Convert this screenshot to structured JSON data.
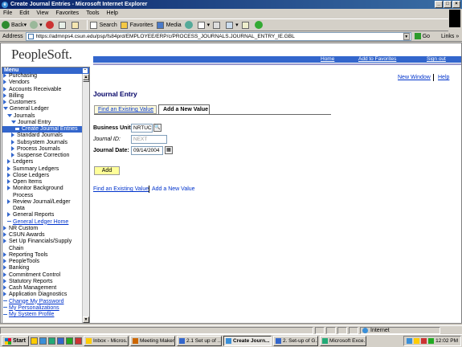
{
  "window": {
    "title": "Create Journal Entries - Microsoft Internet Explorer"
  },
  "menubar": [
    "File",
    "Edit",
    "View",
    "Favorites",
    "Tools",
    "Help"
  ],
  "toolbar": {
    "back": "Back",
    "search": "Search",
    "favorites": "Favorites",
    "media": "Media"
  },
  "address": {
    "label": "Address",
    "url": "https://admnps4.csun.edu/psp/fs84prd/EMPLOYEE/ERP/c/PROCESS_JOURNALS.JOURNAL_ENTRY_IE.GBL",
    "go": "Go",
    "links": "Links"
  },
  "header": {
    "logo": "PeopleSoft.",
    "nav": {
      "home": "Home",
      "add_favorites": "Add to Favorites",
      "sign_out": "Sign out"
    }
  },
  "menu": {
    "title": "Menu",
    "items": [
      {
        "label": "Purchasing",
        "type": "arrow",
        "indent": 0
      },
      {
        "label": "Vendors",
        "type": "arrow",
        "indent": 0
      },
      {
        "label": "Accounts Receivable",
        "type": "arrow",
        "indent": 0
      },
      {
        "label": "Billing",
        "type": "arrow",
        "indent": 0
      },
      {
        "label": "Customers",
        "type": "arrow",
        "indent": 0
      },
      {
        "label": "General Ledger",
        "type": "open",
        "indent": 0
      },
      {
        "label": "Journals",
        "type": "open",
        "indent": 1
      },
      {
        "label": "Journal Entry",
        "type": "open",
        "indent": 2
      },
      {
        "label": "Create Journal Entries",
        "type": "selected",
        "indent": 3
      },
      {
        "label": "Standard Journals",
        "type": "arrow",
        "indent": 2
      },
      {
        "label": "Subsystem Journals",
        "type": "arrow",
        "indent": 2
      },
      {
        "label": "Process Journals",
        "type": "arrow",
        "indent": 2
      },
      {
        "label": "Suspense Correction",
        "type": "arrow",
        "indent": 2
      },
      {
        "label": "Ledgers",
        "type": "arrow",
        "indent": 1
      },
      {
        "label": "Summary Ledgers",
        "type": "arrow",
        "indent": 1
      },
      {
        "label": "Close Ledgers",
        "type": "arrow",
        "indent": 1
      },
      {
        "label": "Open Items",
        "type": "arrow",
        "indent": 1
      },
      {
        "label": "Monitor Background",
        "type": "arrow",
        "indent": 1
      },
      {
        "label": "Process",
        "type": "cont",
        "indent": 1
      },
      {
        "label": "Review Journal/Ledger",
        "type": "arrow",
        "indent": 1
      },
      {
        "label": "Data",
        "type": "cont",
        "indent": 1
      },
      {
        "label": "General Reports",
        "type": "arrow",
        "indent": 1
      },
      {
        "label": "General Ledger Home",
        "type": "link",
        "indent": 1
      },
      {
        "label": "NR Custom",
        "type": "arrow",
        "indent": 0
      },
      {
        "label": "CSUN Awards",
        "type": "arrow",
        "indent": 0
      },
      {
        "label": "Set Up Financials/Supply",
        "type": "arrow",
        "indent": 0
      },
      {
        "label": "Chain",
        "type": "cont",
        "indent": 0
      },
      {
        "label": "Reporting Tools",
        "type": "arrow",
        "indent": 0
      },
      {
        "label": "PeopleTools",
        "type": "arrow",
        "indent": 0
      },
      {
        "label": "Banking",
        "type": "arrow",
        "indent": 0
      },
      {
        "label": "Commitment Control",
        "type": "arrow",
        "indent": 0
      },
      {
        "label": "Statutory Reports",
        "type": "arrow",
        "indent": 0
      },
      {
        "label": "Cash Management",
        "type": "arrow",
        "indent": 0
      },
      {
        "label": "Application Diagnostics",
        "type": "arrow",
        "indent": 0
      },
      {
        "label": "Change My Password",
        "type": "link",
        "indent": 0
      },
      {
        "label": "My Personalizations",
        "type": "link",
        "indent": 0
      },
      {
        "label": "My System Profile",
        "type": "link",
        "indent": 0
      }
    ]
  },
  "main": {
    "new_window": "New Window",
    "help": "Help",
    "page_title": "Journal Entry",
    "tabs": {
      "find": "Find an Existing Value",
      "add": "Add a New Value"
    },
    "form": {
      "business_unit_label": "Business Unit:",
      "business_unit_value": "NRTUC",
      "journal_id_label": "Journal ID:",
      "journal_id_value": "NEXT",
      "journal_date_label": "Journal Date:",
      "journal_date_value": "09/14/2004",
      "add_button": "Add"
    },
    "bottom_links": {
      "find": "Find an Existing Value",
      "add": "Add a New Value"
    }
  },
  "statusbar": {
    "zone": "Internet"
  },
  "taskbar": {
    "start": "Start",
    "tasks": [
      {
        "label": "Inbox - Micros...",
        "active": false
      },
      {
        "label": "Meeting Maker...",
        "active": false
      },
      {
        "label": "2.1 Set up of ...",
        "active": false
      },
      {
        "label": "Create Journ...",
        "active": true
      },
      {
        "label": "2. Set-up of G...",
        "active": false
      },
      {
        "label": "Microsoft Exce...",
        "active": false
      }
    ],
    "clock": "12:02 PM"
  }
}
